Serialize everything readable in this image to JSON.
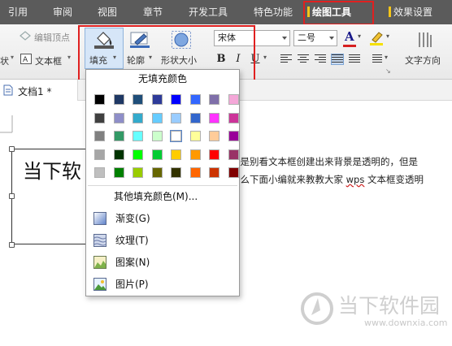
{
  "ribbon_tabs": {
    "ref": "引用",
    "review": "审阅",
    "view": "视图",
    "section": "章节",
    "dev": "开发工具",
    "special": "特色功能",
    "drawing": "绘图工具",
    "effects": "效果设置"
  },
  "ribbon": {
    "edit_vertex": "编辑顶点",
    "shape_cut": "状",
    "textbox": "文本框",
    "fill": "填充",
    "outline": "轮廓",
    "shape_size": "形状大小",
    "font_name": "宋体",
    "font_size": "二号",
    "text_direction": "文字方向",
    "bold": "B",
    "italic": "I",
    "underline": "U",
    "font_color_glyph": "A"
  },
  "document": {
    "tab_title": "文档1 *",
    "textbox_text": "当下软",
    "line1": "但是别看文本框创建出来背景是透明的，但是",
    "line2_before": "那么下面小编就来教教大家 ",
    "line2_wavy": "wps",
    "line2_after": " 文本框变透明"
  },
  "fill_menu": {
    "no_fill": "无填充颜色",
    "swatch_rows": [
      [
        "#000000",
        "#1f3864",
        "#1f4e79",
        "#2e3b99",
        "#0000ff",
        "#3366ff",
        "#7f6fa9",
        "#f4a7d8"
      ],
      [
        "#404040",
        "#8e8ec8",
        "#33aacc",
        "#66ccff",
        "#99ccff",
        "#3366cc",
        "#ff33ff",
        "#cc3399"
      ],
      [
        "#808080",
        "#339966",
        "#66ffff",
        "#ccffcc",
        "#ffffff",
        "#ffff99",
        "#ffcc99",
        "#990099"
      ],
      [
        "#a6a6a6",
        "#003300",
        "#00ff00",
        "#00cc33",
        "#ffcc00",
        "#ff9900",
        "#ff0000",
        "#993366"
      ],
      [
        "#bfbfbf",
        "#008000",
        "#99cc00",
        "#666600",
        "#333300",
        "#ff6600",
        "#cc3300",
        "#800000"
      ]
    ],
    "selected_swatch": "#ffffff",
    "other_colors": "其他填充颜色(M)...",
    "gradient": "渐变(G)",
    "texture": "纹理(T)",
    "pattern": "图案(N)",
    "picture": "图片(P)"
  },
  "watermark": {
    "brand": "当下软件园",
    "url": "www.downxia.com"
  },
  "colors": {
    "highlight": "#e02020",
    "tabbar": "#5b5b5b",
    "accent": "#f5c518"
  }
}
